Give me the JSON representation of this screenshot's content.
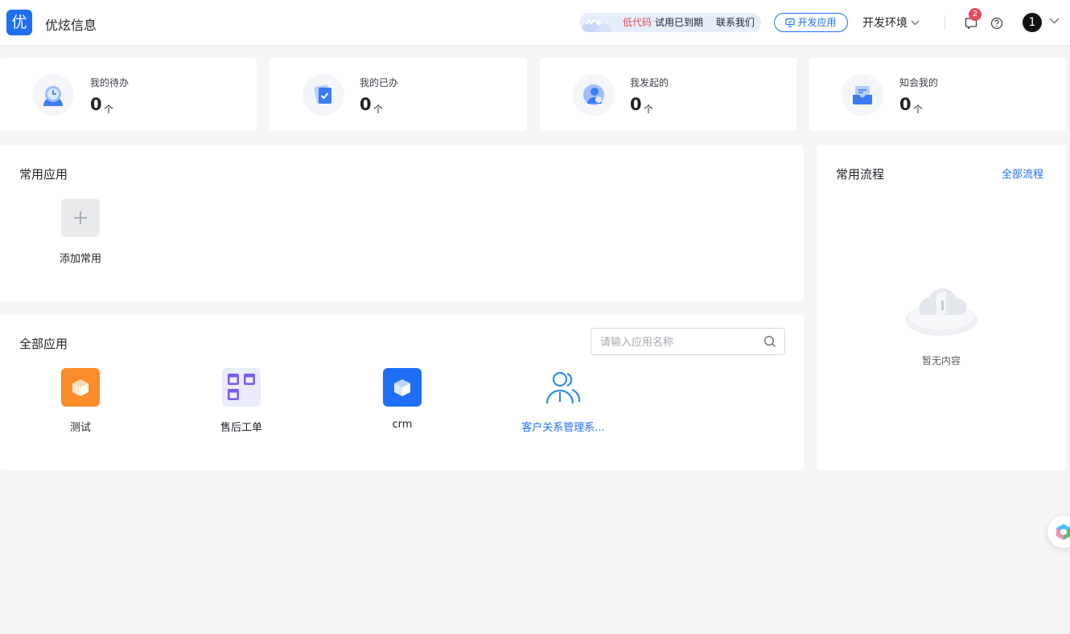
{
  "header": {
    "logo_char": "优",
    "app_title": "优炫信息",
    "trial": {
      "lowcode": "低代码",
      "expired": "试用已到期",
      "contact": "联系我们"
    },
    "dev_app_label": "开发应用",
    "env_label": "开发环境",
    "notification_count": "2",
    "avatar_label": "1"
  },
  "stats": [
    {
      "label": "我的待办",
      "value": "0",
      "unit": "个",
      "icon": "alarm-clock-icon"
    },
    {
      "label": "我的已办",
      "value": "0",
      "unit": "个",
      "icon": "clipboard-check-icon"
    },
    {
      "label": "我发起的",
      "value": "0",
      "unit": "个",
      "icon": "user-icon"
    },
    {
      "label": "知会我的",
      "value": "0",
      "unit": "个",
      "icon": "inbox-icon"
    }
  ],
  "frequent_apps": {
    "title": "常用应用",
    "add_label": "添加常用"
  },
  "all_apps": {
    "title": "全部应用",
    "search_placeholder": "请输入应用名称",
    "items": [
      {
        "name": "测试",
        "icon": "orange-cube-icon",
        "color": "#fa8c2a"
      },
      {
        "name": "售后工单",
        "icon": "calendar-grid-icon",
        "color": "#e8ecfb"
      },
      {
        "name": "crm",
        "icon": "blue-cube-icon",
        "color": "#1e6ff5"
      },
      {
        "name": "客户关系管理系...",
        "icon": "users-icon",
        "color": "#1e6ff5"
      }
    ]
  },
  "frequent_flows": {
    "title": "常用流程",
    "all_link": "全部流程",
    "empty_text": "暂无内容"
  },
  "colors": {
    "accent": "#1e6ff5",
    "danger": "#e34d59",
    "background": "#f4f5f7"
  }
}
